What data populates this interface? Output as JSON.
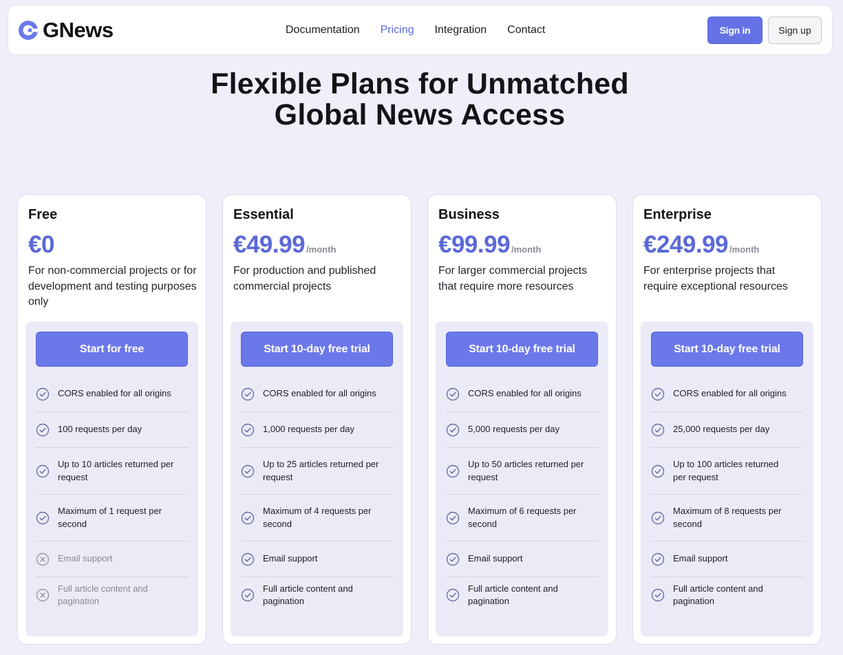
{
  "brand": {
    "name": "GNews",
    "accent": "#5b69d6"
  },
  "nav": {
    "items": [
      {
        "label": "Documentation",
        "active": false
      },
      {
        "label": "Pricing",
        "active": true
      },
      {
        "label": "Integration",
        "active": false
      },
      {
        "label": "Contact",
        "active": false
      }
    ],
    "signin_label": "Sign in",
    "signup_label": "Sign up"
  },
  "hero": {
    "line1": "Flexible Plans for Unmatched",
    "line2": "Global News Access"
  },
  "plans": [
    {
      "name": "Free",
      "price": "€0",
      "period": "",
      "description": "For non-commercial projects or for development and testing purposes only",
      "cta": "Start for free",
      "features": [
        {
          "text": "CORS enabled for all origins",
          "included": true
        },
        {
          "text": "100 requests per day",
          "included": true
        },
        {
          "text": "Up to 10 articles returned per request",
          "included": true
        },
        {
          "text": "Maximum of 1 request per second",
          "included": true
        },
        {
          "text": "Email support",
          "included": false
        },
        {
          "text": "Full article content and pagination",
          "included": false
        }
      ]
    },
    {
      "name": "Essential",
      "price": "€49.99",
      "period": "/month",
      "description": "For production and published commercial projects",
      "cta": "Start 10-day free trial",
      "features": [
        {
          "text": "CORS enabled for all origins",
          "included": true
        },
        {
          "text": "1,000 requests per day",
          "included": true
        },
        {
          "text": "Up to 25 articles returned per request",
          "included": true
        },
        {
          "text": "Maximum of 4 requests per second",
          "included": true
        },
        {
          "text": "Email support",
          "included": true
        },
        {
          "text": "Full article content and pagination",
          "included": true
        }
      ]
    },
    {
      "name": "Business",
      "price": "€99.99",
      "period": "/month",
      "description": "For larger commercial projects that require more resources",
      "cta": "Start 10-day free trial",
      "features": [
        {
          "text": "CORS enabled for all origins",
          "included": true
        },
        {
          "text": "5,000 requests per day",
          "included": true
        },
        {
          "text": "Up to 50 articles returned per request",
          "included": true
        },
        {
          "text": "Maximum of 6 requests per second",
          "included": true
        },
        {
          "text": "Email support",
          "included": true
        },
        {
          "text": "Full article content and pagination",
          "included": true
        }
      ]
    },
    {
      "name": "Enterprise",
      "price": "€249.99",
      "period": "/month",
      "description": "For enterprise projects that require exceptional resources",
      "cta": "Start 10-day free trial",
      "features": [
        {
          "text": "CORS enabled for all origins",
          "included": true
        },
        {
          "text": "25,000 requests per day",
          "included": true
        },
        {
          "text": "Up to 100 articles returned per request",
          "included": true
        },
        {
          "text": "Maximum of 8 requests per second",
          "included": true
        },
        {
          "text": "Email support",
          "included": true
        },
        {
          "text": "Full article content and pagination",
          "included": true
        }
      ]
    }
  ],
  "icons": {
    "included": "check-circle-icon",
    "excluded": "x-circle-icon"
  }
}
